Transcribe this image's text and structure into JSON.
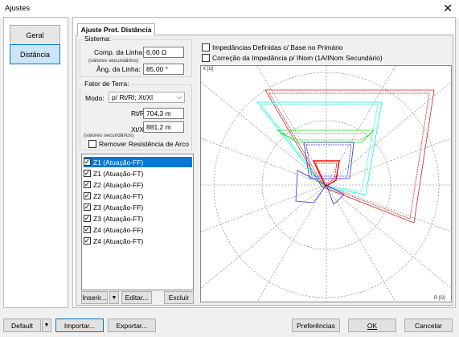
{
  "window": {
    "title": "Ajustes"
  },
  "nav": {
    "items": [
      "Geral",
      "Distância"
    ],
    "active": 1
  },
  "tab": {
    "label": "Ajuste Prot. Distância"
  },
  "sistema": {
    "label": "Sistema:",
    "comp_label": "Comp. da Linha:",
    "comp_value": "6,00 Ω",
    "valores_sec": "(valores secundários)",
    "ang_label": "Âng. da Linha:",
    "ang_value": "85,00 °"
  },
  "fator": {
    "label": "Fator de Terra:",
    "modo_label": "Modo:",
    "modo_value": "p/ Rt/Rl; Xt/Xl",
    "rt_label": "Rt/Rl:",
    "rt_value": "704,3 m",
    "xt_label": "Xt/Xl:",
    "xt_value": "881,2 m",
    "valores_sec": "(valores secundários)",
    "remover_label": "Remover Resistência de Arco"
  },
  "zones": [
    {
      "label": "Z1 (Atuação-FF)",
      "checked": true
    },
    {
      "label": "Z1 (Atuação-FT)",
      "checked": true
    },
    {
      "label": "Z2 (Atuação-FF)",
      "checked": true
    },
    {
      "label": "Z2 (Atuação-FT)",
      "checked": true
    },
    {
      "label": "Z3 (Atuação-FF)",
      "checked": true
    },
    {
      "label": "Z3 (Atuação-FT)",
      "checked": true
    },
    {
      "label": "Z4 (Atuação-FF)",
      "checked": true
    },
    {
      "label": "Z4 (Atuação-FT)",
      "checked": true
    }
  ],
  "list_buttons": {
    "inserir": "Inserir...",
    "editar": "Editar...",
    "excluir": "Excluir"
  },
  "options": {
    "imp_base": "Impedâncias Definidas c/ Base no Primário",
    "corr_imp": "Correção da Impedância p/ INom (1A/INom Secundário)"
  },
  "plot": {
    "y_axis": "X [Ω]",
    "x_axis": "R [Ω]"
  },
  "footer": {
    "default": "Default",
    "importar": "Importar...",
    "exportar": "Exportar...",
    "preferencias": "Preferências",
    "ok": "OK",
    "cancelar": "Cancelar"
  },
  "colors": {
    "selection": "#0078d7",
    "z1": "#ff0000",
    "z2": "#00ffcc",
    "z3": "#22dd22",
    "z4": "#cc2222",
    "blue_zone": "#3333cc"
  }
}
